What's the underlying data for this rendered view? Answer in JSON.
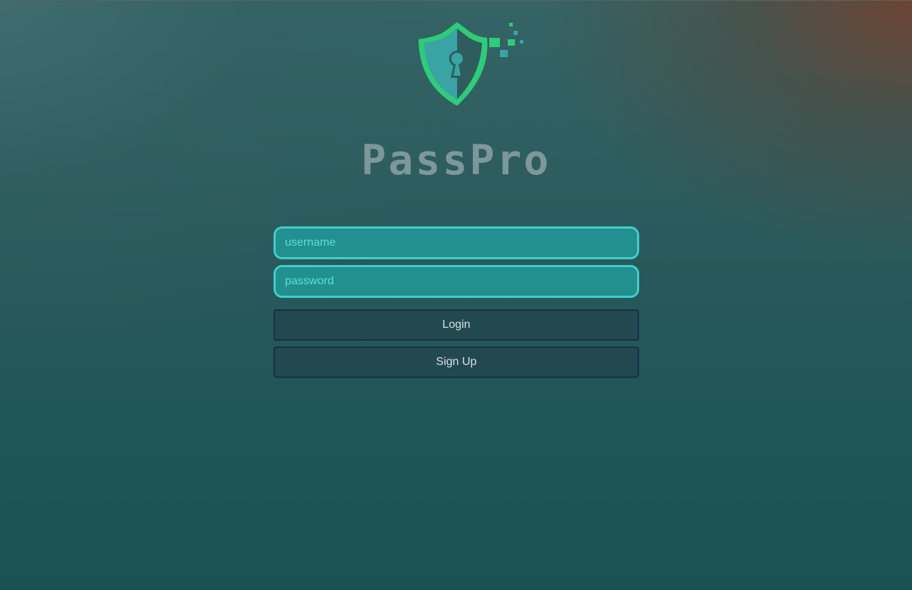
{
  "app": {
    "title": "PassPro",
    "logo_icon": "shield-keyhole-icon",
    "accent_color": "#2ecc78",
    "secondary_color": "#3aa3a4"
  },
  "login_form": {
    "username": {
      "placeholder": "username",
      "value": ""
    },
    "password": {
      "placeholder": "password",
      "value": ""
    },
    "login_label": "Login",
    "signup_label": "Sign Up"
  }
}
